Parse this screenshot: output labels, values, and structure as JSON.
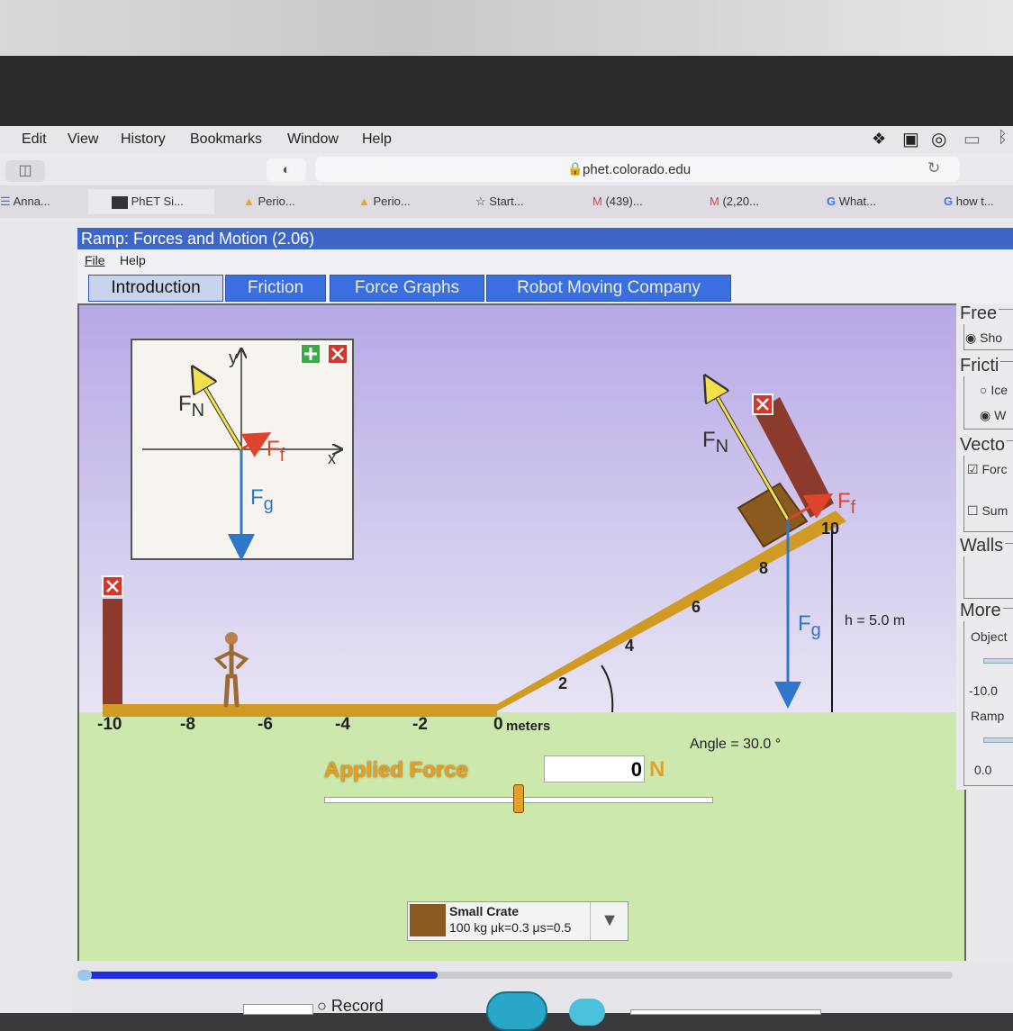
{
  "browser": {
    "menu": [
      "Edit",
      "View",
      "History",
      "Bookmarks",
      "Window",
      "Help"
    ],
    "url": "phet.colorado.edu",
    "tabs": [
      "Anna...",
      "PhET Si...",
      "Perio...",
      "Perio...",
      "Start...",
      "(439)...",
      "(2,20...",
      "What...",
      "how t..."
    ]
  },
  "app": {
    "title": "Ramp: Forces and Motion (2.06)",
    "menu": [
      "File",
      "Help"
    ],
    "tabs": [
      "Introduction",
      "Friction",
      "Force Graphs",
      "Robot Moving Company"
    ],
    "active_tab": "Introduction"
  },
  "fbd": {
    "y_label": "y",
    "x_label": "x",
    "fn": "F",
    "fn_sub": "N",
    "ff": "F",
    "ff_sub": "f",
    "fg": "F",
    "fg_sub": "g"
  },
  "scene": {
    "axis_ticks": [
      "-10",
      "-8",
      "-6",
      "-4",
      "-2",
      "0"
    ],
    "axis_unit": "meters",
    "ramp_ticks": [
      "2",
      "4",
      "6",
      "8",
      "10"
    ],
    "height_label": "h = 5.0 m",
    "angle_label": "Angle = 30.0 °",
    "fn": "F",
    "fn_sub": "N",
    "ff": "F",
    "ff_sub": "f",
    "fg": "F",
    "fg_sub": "g"
  },
  "applied_force": {
    "label": "Applied Force",
    "value": "0",
    "unit": "N",
    "slider_fraction": 0.5
  },
  "object_selector": {
    "name": "Small Crate",
    "mass": "100 kg",
    "mu_k": "μk=0.3",
    "mu_s": "μs=0.5"
  },
  "sidebar": {
    "free": "Free",
    "show": "Sho",
    "friction": "Fricti",
    "ice": "Ice",
    "wood": "W",
    "vectors": "Vecto",
    "forces": "Forc",
    "sum": "Sum",
    "walls": "Walls",
    "more": "More",
    "object": "Object",
    "object_min": "-10.0",
    "ramp": "Ramp",
    "ramp_min": "0.0"
  },
  "playback": {
    "record": "Record",
    "progress_fraction": 0.41
  },
  "colors": {
    "ramp": "#d19a22",
    "normal": "#f2e04a",
    "friction": "#e0432b",
    "gravity": "#2f77c9",
    "title_bar": "#3d66c8",
    "tab": "#3b6fe0"
  }
}
